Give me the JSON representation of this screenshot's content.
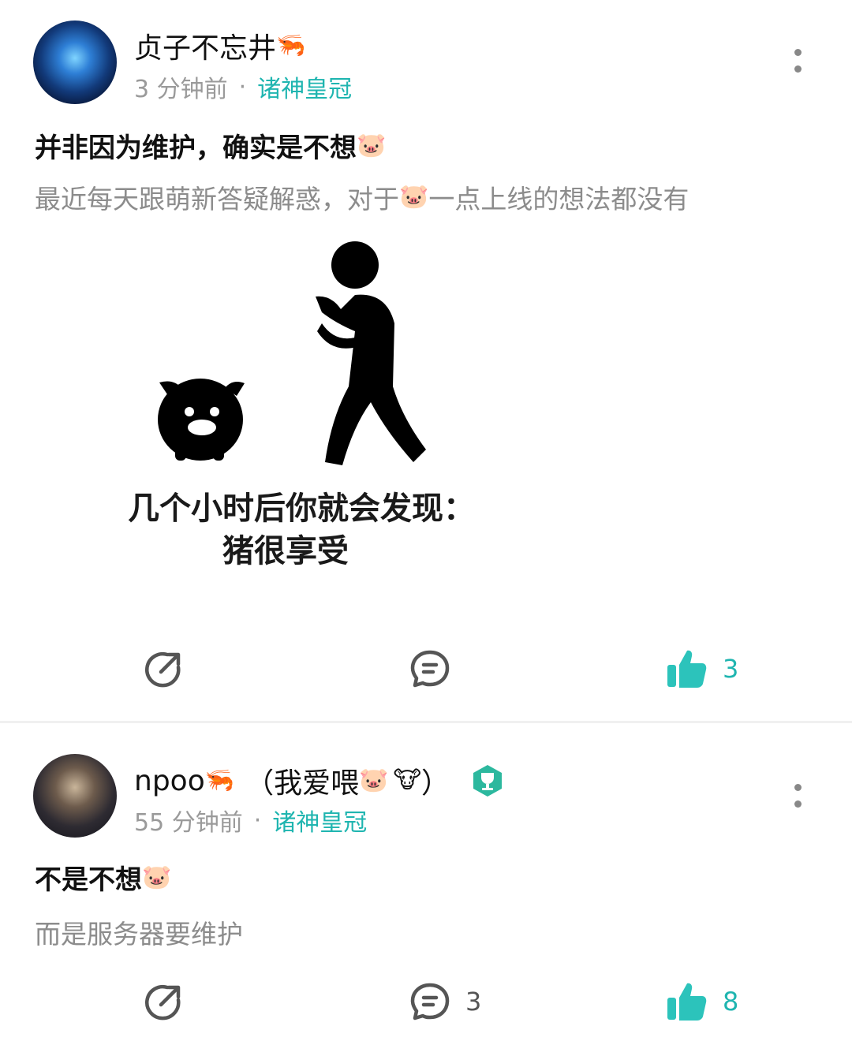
{
  "posts": [
    {
      "username": "贞子不忘井",
      "user_emoji": "🦐",
      "time": "3 分钟前",
      "separator": "·",
      "forum": "诸神皇冠",
      "title": "并非因为维护，确实是不想",
      "title_emoji": "🐷",
      "body_before": "最近每天跟萌新答疑解惑，对于",
      "body_emoji": "🐷",
      "body_after": "一点上线的想法都没有",
      "meme": {
        "line1": "几个小时后你就会发现：",
        "line2": "猪很享受"
      },
      "actions": {
        "share_icon": "share-icon",
        "comment_icon": "comment-icon",
        "comment_count": "",
        "like_icon": "thumbs-up-icon",
        "like_count": "3"
      }
    },
    {
      "username": "npoo",
      "user_emoji": "🦐",
      "username_suffix_open": "（我爱喂",
      "suffix_emoji1": "🐷",
      "suffix_emoji2": "🐮",
      "username_suffix_close": "）",
      "time": "55 分钟前",
      "separator": "·",
      "forum": "诸神皇冠",
      "title": "不是不想",
      "title_emoji": "🐷",
      "body": "而是服务器要维护",
      "actions": {
        "share_icon": "share-icon",
        "comment_icon": "comment-icon",
        "comment_count": "3",
        "like_icon": "thumbs-up-icon",
        "like_count": "8"
      }
    }
  ],
  "colors": {
    "accent": "#1fb5b0",
    "meta": "#9a9a9a",
    "body": "#8c8c8c",
    "icon": "#555555"
  }
}
